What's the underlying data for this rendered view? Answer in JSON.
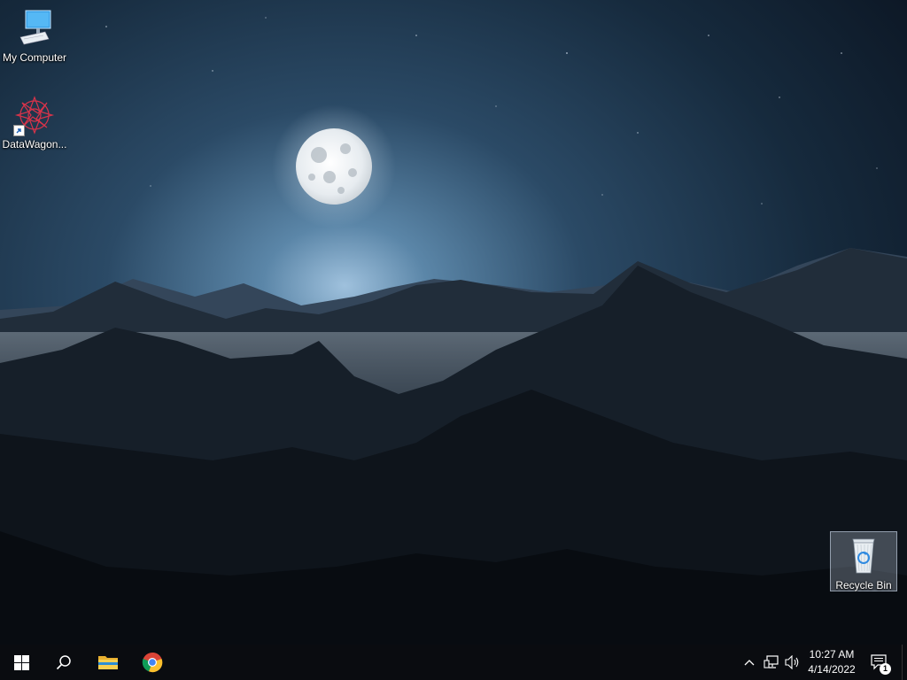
{
  "desktop": {
    "icons": [
      {
        "label": "My Computer",
        "icon": "monitor-icon"
      },
      {
        "label": "DataWagon...",
        "icon": "datawagon-icon"
      },
      {
        "label": "Recycle Bin",
        "icon": "recycle-bin-icon"
      }
    ]
  },
  "taskbar": {
    "start": "start-icon",
    "search": "search-icon",
    "pinned": [
      "file-explorer-icon",
      "chrome-icon"
    ],
    "tray": {
      "chevron": "chevron-up-icon",
      "network": "network-icon",
      "volume": "volume-icon",
      "time": "10:27 AM",
      "date": "4/14/2022",
      "notifications_count": "1"
    }
  },
  "colors": {
    "taskbar": "#0a0c10",
    "sky_top": "#0e1a2a",
    "sky_glow": "#9fc1dd",
    "recycle_highlight": "#c8d7eb"
  }
}
